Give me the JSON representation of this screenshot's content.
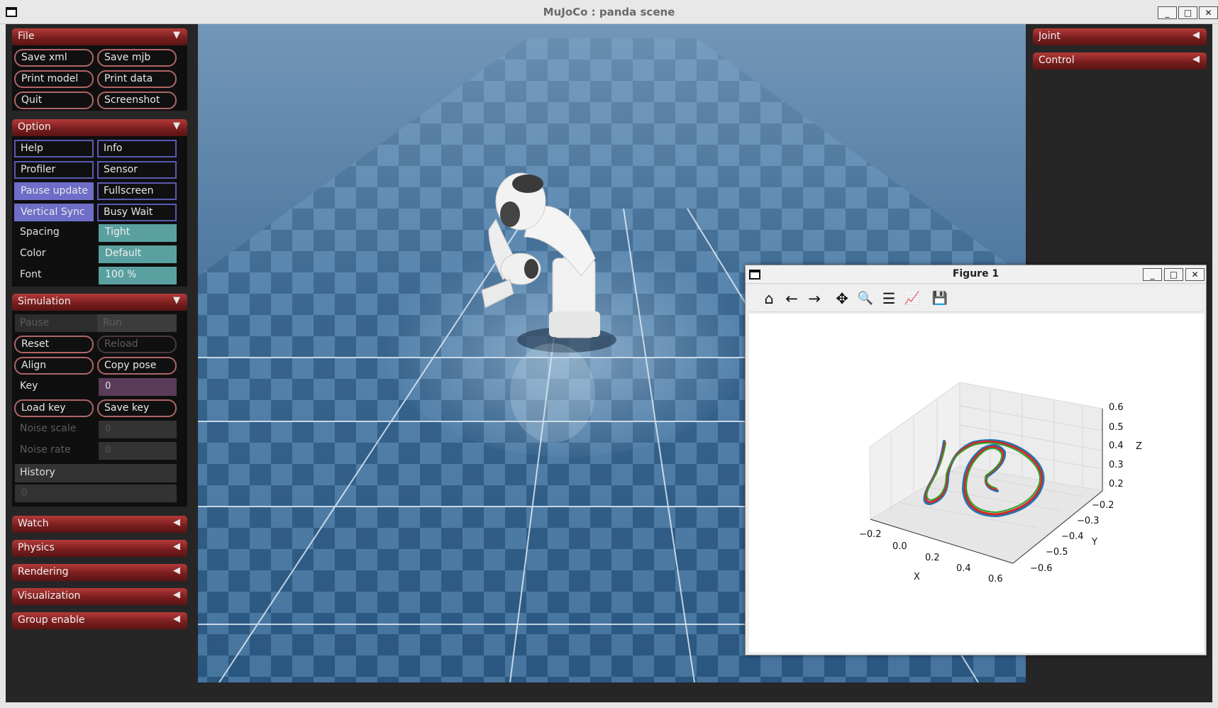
{
  "window": {
    "title": "MuJoCo : panda scene",
    "btn_min": "_",
    "btn_max": "□",
    "btn_close": "✕"
  },
  "left": {
    "file": {
      "title": "File",
      "arrow": "▼",
      "buttons": [
        "Save xml",
        "Save mjb",
        "Print model",
        "Print data",
        "Quit",
        "Screenshot"
      ]
    },
    "option": {
      "title": "Option",
      "arrow": "▼",
      "toggles": [
        "Help",
        "Info",
        "Profiler",
        "Sensor",
        "Pause update",
        "Fullscreen",
        "Vertical Sync",
        "Busy Wait"
      ],
      "toggles_on": [
        "Pause update",
        "Vertical Sync"
      ],
      "spacing_label": "Spacing",
      "spacing_value": "Tight",
      "color_label": "Color",
      "color_value": "Default",
      "font_label": "Font",
      "font_value": "100 %"
    },
    "simulation": {
      "title": "Simulation",
      "arrow": "▼",
      "pause": "Pause",
      "run": "Run",
      "reset": "Reset",
      "reload": "Reload",
      "align": "Align",
      "copy_pose": "Copy pose",
      "key_label": "Key",
      "key_value": "0",
      "load_key": "Load key",
      "save_key": "Save key",
      "noise_scale_label": "Noise scale",
      "noise_scale_value": "0",
      "noise_rate_label": "Noise rate",
      "noise_rate_value": "0",
      "history_label": "History",
      "history_value": "0"
    },
    "collapsed": [
      {
        "title": "Watch",
        "arrow": "◀"
      },
      {
        "title": "Physics",
        "arrow": "◀"
      },
      {
        "title": "Rendering",
        "arrow": "◀"
      },
      {
        "title": "Visualization",
        "arrow": "◀"
      },
      {
        "title": "Group enable",
        "arrow": "◀"
      }
    ]
  },
  "right": {
    "joint": {
      "title": "Joint",
      "arrow": "◀"
    },
    "control": {
      "title": "Control",
      "arrow": "◀"
    }
  },
  "figure": {
    "title": "Figure 1",
    "toolbar": [
      {
        "icon": "home-icon",
        "glyph": "⌂"
      },
      {
        "icon": "back-icon",
        "glyph": "←"
      },
      {
        "icon": "forward-icon",
        "glyph": "→"
      },
      {
        "icon": "pan-icon",
        "glyph": "✥"
      },
      {
        "icon": "zoom-icon",
        "glyph": "🔍"
      },
      {
        "icon": "subplots-icon",
        "glyph": "☰"
      },
      {
        "icon": "edit-axis-icon",
        "glyph": "📈"
      },
      {
        "icon": "save-icon",
        "glyph": "💾"
      }
    ],
    "plot": {
      "x_label": "X",
      "y_label": "Y",
      "z_label": "Z",
      "x_ticks": [
        "−0.2",
        "0.0",
        "0.2",
        "0.4",
        "0.6"
      ],
      "y_ticks": [
        "−0.2",
        "−0.3",
        "−0.4",
        "−0.5",
        "−0.6"
      ],
      "z_ticks": [
        "0.6",
        "0.5",
        "0.4",
        "0.3",
        "0.2"
      ],
      "series_colors": [
        "#1f77b4",
        "#d62728",
        "#2ca02c"
      ]
    }
  }
}
